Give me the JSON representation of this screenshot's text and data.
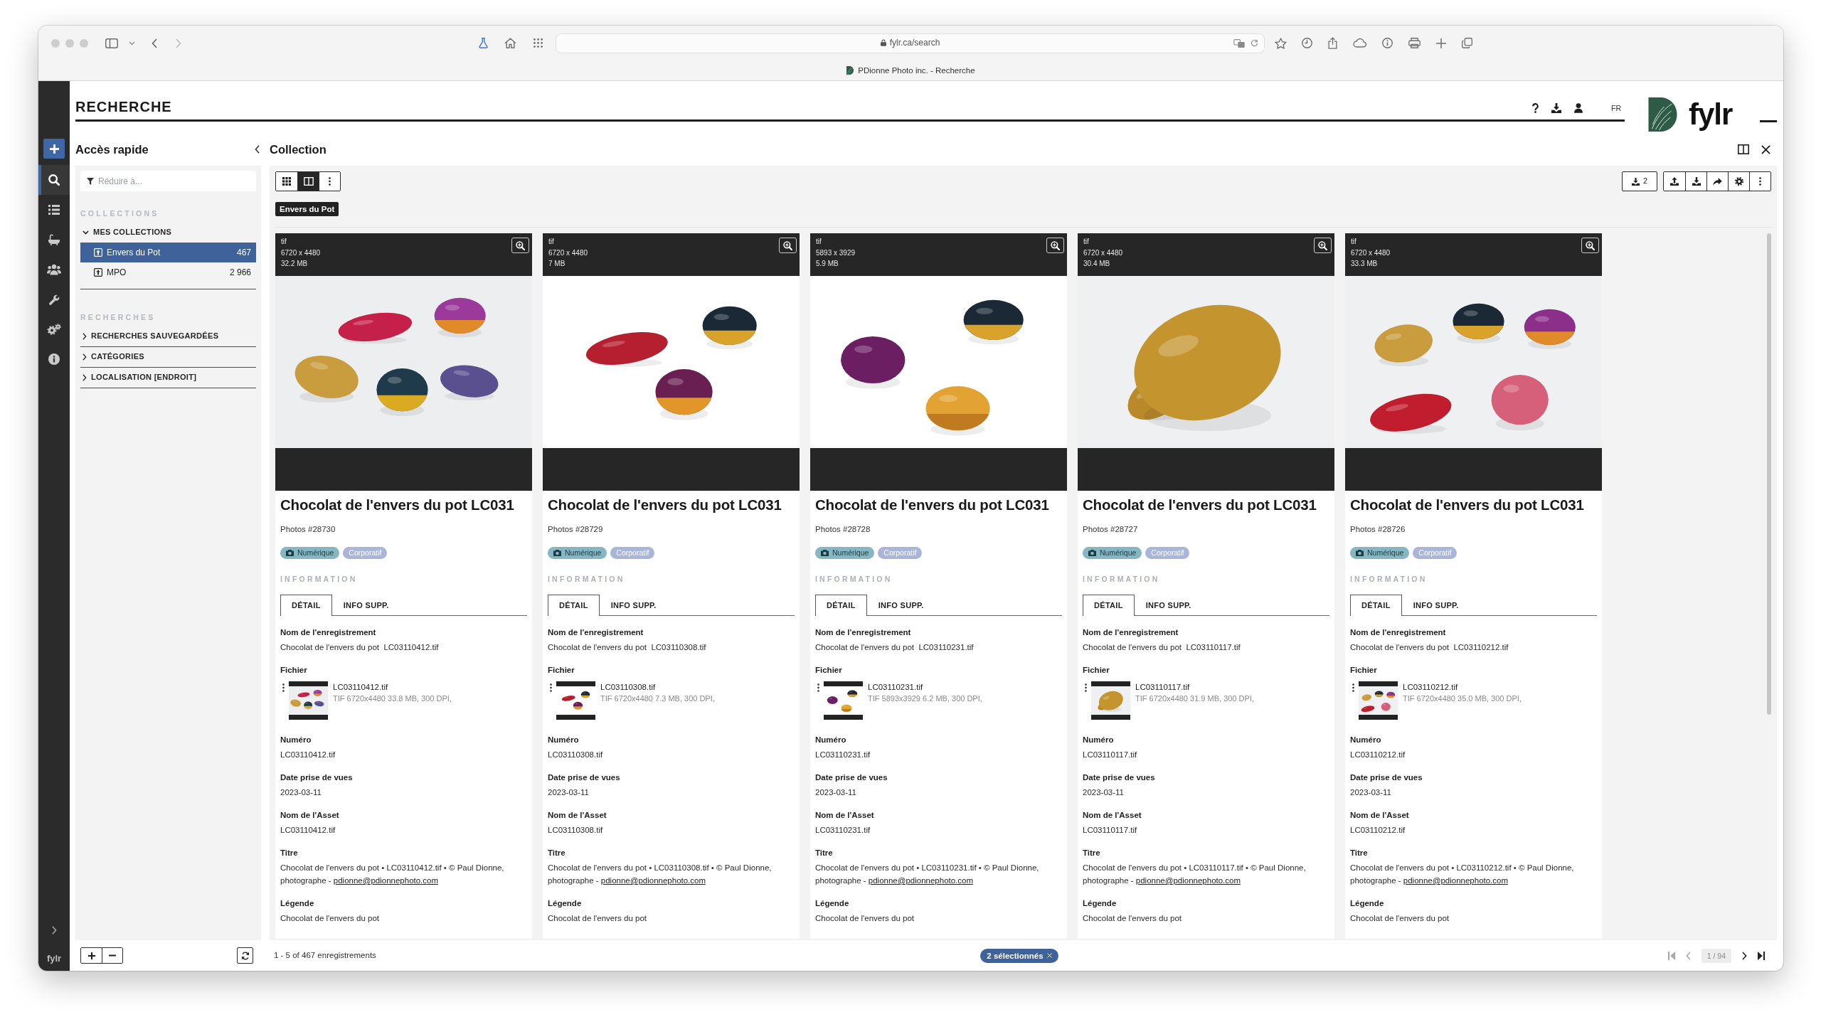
{
  "browser": {
    "address": "fylr.ca/search",
    "tab_title": "PDionne Photo inc. - Recherche"
  },
  "header": {
    "title": "RECHERCHE",
    "language": "FR",
    "logo_text": "fylr"
  },
  "nav_rail": {
    "items": [
      {
        "kind": "search",
        "selected": true
      },
      {
        "kind": "list",
        "selected": false
      },
      {
        "kind": "tub",
        "selected": false
      },
      {
        "kind": "users",
        "selected": false
      },
      {
        "kind": "wrench",
        "selected": false
      },
      {
        "kind": "gears",
        "selected": false
      },
      {
        "kind": "info",
        "selected": false
      }
    ],
    "logo_text": "fylr"
  },
  "quick_access": {
    "title": "Accès rapide",
    "filter": {
      "placeholder": "Réduire à..."
    },
    "sections": [
      {
        "heading": "COLLECTIONS",
        "groups": [
          {
            "label": "MES COLLECTIONS",
            "expanded": true,
            "children": [
              {
                "label": "Envers du Pot",
                "count": "467",
                "selected": true
              },
              {
                "label": "MPO",
                "count": "2 966",
                "selected": false
              }
            ]
          }
        ]
      },
      {
        "heading": "RECHERCHES",
        "groups": [
          {
            "label": "RECHERCHES SAUVEGARDÉES",
            "expanded": false
          },
          {
            "label": "CATÉGORIES",
            "expanded": false
          },
          {
            "label": "LOCALISATION [ENDROIT]",
            "expanded": false
          }
        ]
      }
    ]
  },
  "collection": {
    "title": "Collection",
    "view_modes": [
      {
        "kind": "grid",
        "selected": false
      },
      {
        "kind": "split",
        "selected": true
      }
    ],
    "download_count": "2",
    "filter_tag": "Envers du Pot",
    "cards": [
      {
        "format": "tif",
        "dimensions": "6720 x 4480",
        "size": "32.2 MB",
        "title": "Chocolat de l'envers du pot LC031",
        "pool": "Photos #28730",
        "tags": [
          {
            "kind": "media",
            "label": "Numérique",
            "color": "#86b6c2"
          },
          {
            "kind": "label",
            "label": "Corporatif",
            "color": "#a9b6d9"
          }
        ],
        "section": "INFORMATION",
        "tabs": [
          {
            "label": "DÉTAIL",
            "selected": true
          },
          {
            "label": "INFO SUPP.",
            "selected": false
          }
        ],
        "fields": [
          {
            "kind": "text",
            "label": "Nom de l'enregistrement",
            "value": "Chocolat de l'envers du pot  LC03110412.tif"
          },
          {
            "kind": "file",
            "label": "Fichier",
            "file_name": "LC03110412.tif",
            "file_info": "TIF 6720x4480 33.8 MB, 300 DPI,"
          },
          {
            "kind": "text",
            "label": "Numéro",
            "value": "LC03110412.tif"
          },
          {
            "kind": "text",
            "label": "Date prise de vues",
            "value": "2023-03-11"
          },
          {
            "kind": "text",
            "label": "Nom de l'Asset",
            "value": "LC03110412.tif"
          },
          {
            "kind": "text",
            "label": "Titre",
            "value": "Chocolat de l'envers du pot • LC03110412.tif • © Paul Dionne, photographe - ",
            "link": "pdionne@pdionnephoto.com"
          },
          {
            "kind": "text",
            "label": "Légende",
            "value": "Chocolat de l'envers du pot"
          }
        ]
      },
      {
        "format": "tif",
        "dimensions": "6720 x 4480",
        "size": "7 MB",
        "title": "Chocolat de l'envers du pot LC031",
        "pool": "Photos #28729",
        "tags": [
          {
            "kind": "media",
            "label": "Numérique",
            "color": "#86b6c2"
          },
          {
            "kind": "label",
            "label": "Corporatif",
            "color": "#a9b6d9"
          }
        ],
        "section": "INFORMATION",
        "tabs": [
          {
            "label": "DÉTAIL",
            "selected": true
          },
          {
            "label": "INFO SUPP.",
            "selected": false
          }
        ],
        "fields": [
          {
            "kind": "text",
            "label": "Nom de l'enregistrement",
            "value": "Chocolat de l'envers du pot  LC03110308.tif"
          },
          {
            "kind": "file",
            "label": "Fichier",
            "file_name": "LC03110308.tif",
            "file_info": "TIF 6720x4480 7.3 MB, 300 DPI,"
          },
          {
            "kind": "text",
            "label": "Numéro",
            "value": "LC03110308.tif"
          },
          {
            "kind": "text",
            "label": "Date prise de vues",
            "value": "2023-03-11"
          },
          {
            "kind": "text",
            "label": "Nom de l'Asset",
            "value": "LC03110308.tif"
          },
          {
            "kind": "text",
            "label": "Titre",
            "value": "Chocolat de l'envers du pot • LC03110308.tif • © Paul Dionne, photographe - ",
            "link": "pdionne@pdionnephoto.com"
          },
          {
            "kind": "text",
            "label": "Légende",
            "value": "Chocolat de l'envers du pot"
          }
        ]
      },
      {
        "format": "tif",
        "dimensions": "5893 x 3929",
        "size": "5.9 MB",
        "title": "Chocolat de l'envers du pot LC031",
        "pool": "Photos #28728",
        "tags": [
          {
            "kind": "media",
            "label": "Numérique",
            "color": "#86b6c2"
          },
          {
            "kind": "label",
            "label": "Corporatif",
            "color": "#a9b6d9"
          }
        ],
        "section": "INFORMATION",
        "tabs": [
          {
            "label": "DÉTAIL",
            "selected": true
          },
          {
            "label": "INFO SUPP.",
            "selected": false
          }
        ],
        "fields": [
          {
            "kind": "text",
            "label": "Nom de l'enregistrement",
            "value": "Chocolat de l'envers du pot  LC03110231.tif"
          },
          {
            "kind": "file",
            "label": "Fichier",
            "file_name": "LC03110231.tif",
            "file_info": "TIF 5893x3929 6.2 MB, 300 DPI,"
          },
          {
            "kind": "text",
            "label": "Numéro",
            "value": "LC03110231.tif"
          },
          {
            "kind": "text",
            "label": "Date prise de vues",
            "value": "2023-03-11"
          },
          {
            "kind": "text",
            "label": "Nom de l'Asset",
            "value": "LC03110231.tif"
          },
          {
            "kind": "text",
            "label": "Titre",
            "value": "Chocolat de l'envers du pot • LC03110231.tif • © Paul Dionne, photographe - ",
            "link": "pdionne@pdionnephoto.com"
          },
          {
            "kind": "text",
            "label": "Légende",
            "value": "Chocolat de l'envers du pot"
          }
        ]
      },
      {
        "format": "tif",
        "dimensions": "6720 x 4480",
        "size": "30.4 MB",
        "title": "Chocolat de l'envers du pot LC031",
        "pool": "Photos #28727",
        "tags": [
          {
            "kind": "media",
            "label": "Numérique",
            "color": "#86b6c2"
          },
          {
            "kind": "label",
            "label": "Corporatif",
            "color": "#a9b6d9"
          }
        ],
        "section": "INFORMATION",
        "tabs": [
          {
            "label": "DÉTAIL",
            "selected": true
          },
          {
            "label": "INFO SUPP.",
            "selected": false
          }
        ],
        "fields": [
          {
            "kind": "text",
            "label": "Nom de l'enregistrement",
            "value": "Chocolat de l'envers du pot  LC03110117.tif"
          },
          {
            "kind": "file",
            "label": "Fichier",
            "file_name": "LC03110117.tif",
            "file_info": "TIF 6720x4480 31.9 MB, 300 DPI,"
          },
          {
            "kind": "text",
            "label": "Numéro",
            "value": "LC03110117.tif"
          },
          {
            "kind": "text",
            "label": "Date prise de vues",
            "value": "2023-03-11"
          },
          {
            "kind": "text",
            "label": "Nom de l'Asset",
            "value": "LC03110117.tif"
          },
          {
            "kind": "text",
            "label": "Titre",
            "value": "Chocolat de l'envers du pot • LC03110117.tif • © Paul Dionne, photographe - ",
            "link": "pdionne@pdionnephoto.com"
          },
          {
            "kind": "text",
            "label": "Légende",
            "value": "Chocolat de l'envers du pot"
          }
        ]
      },
      {
        "format": "tif",
        "dimensions": "6720 x 4480",
        "size": "33.3 MB",
        "title": "Chocolat de l'envers du pot LC031",
        "pool": "Photos #28726",
        "tags": [
          {
            "kind": "media",
            "label": "Numérique",
            "color": "#86b6c2"
          },
          {
            "kind": "label",
            "label": "Corporatif",
            "color": "#a9b6d9"
          }
        ],
        "section": "INFORMATION",
        "tabs": [
          {
            "label": "DÉTAIL",
            "selected": true
          },
          {
            "label": "INFO SUPP.",
            "selected": false
          }
        ],
        "fields": [
          {
            "kind": "text",
            "label": "Nom de l'enregistrement",
            "value": "Chocolat de l'envers du pot  LC03110212.tif"
          },
          {
            "kind": "file",
            "label": "Fichier",
            "file_name": "LC03110212.tif",
            "file_info": "TIF 6720x4480 35.0 MB, 300 DPI,"
          },
          {
            "kind": "text",
            "label": "Numéro",
            "value": "LC03110212.tif"
          },
          {
            "kind": "text",
            "label": "Date prise de vues",
            "value": "2023-03-11"
          },
          {
            "kind": "text",
            "label": "Nom de l'Asset",
            "value": "LC03110212.tif"
          },
          {
            "kind": "text",
            "label": "Titre",
            "value": "Chocolat de l'envers du pot • LC03110212.tif • © Paul Dionne, photographe - ",
            "link": "pdionne@pdionnephoto.com"
          },
          {
            "kind": "text",
            "label": "Légende",
            "value": "Chocolat de l'envers du pot"
          }
        ]
      }
    ]
  },
  "footer": {
    "count_text": "1 - 5 of 467 enregistrements",
    "selection": "2 sélectionnés",
    "pager": {
      "page": "1 / 94",
      "buttons": [
        {
          "kind": "first",
          "disabled": true
        },
        {
          "kind": "prev",
          "disabled": true
        },
        {
          "kind": "next",
          "disabled": false
        },
        {
          "kind": "last",
          "disabled": false
        }
      ]
    }
  }
}
